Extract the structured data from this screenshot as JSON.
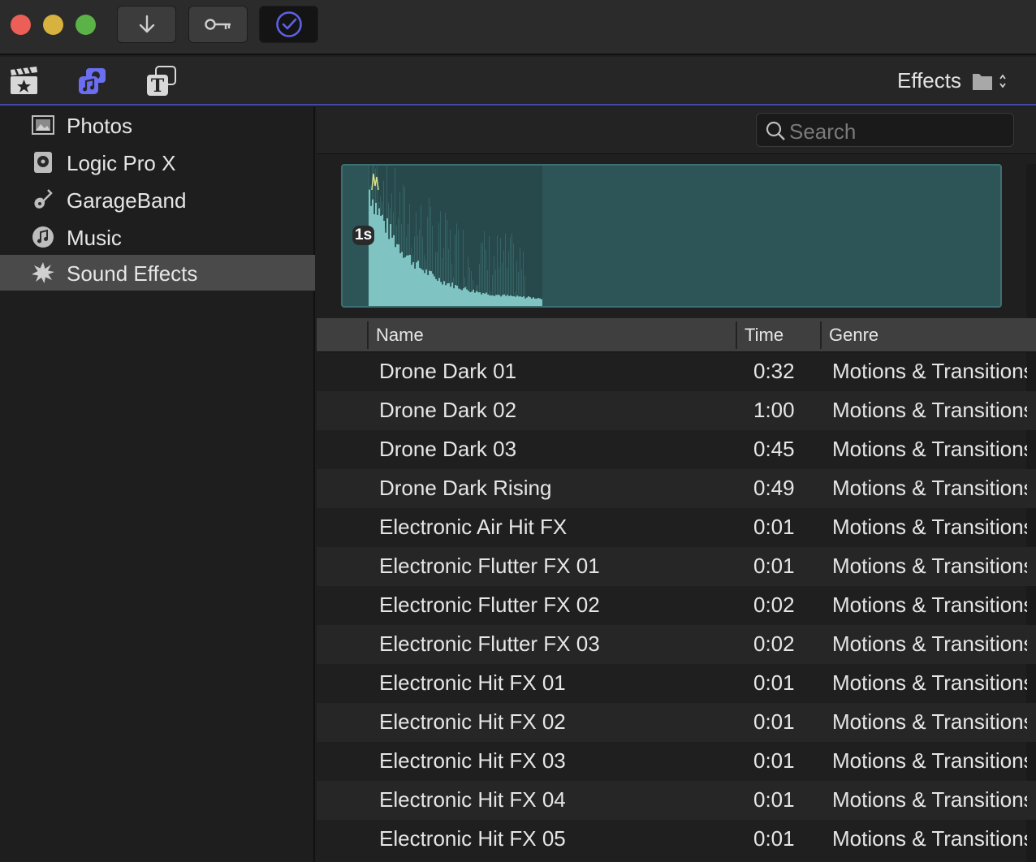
{
  "window": {
    "buttons": [
      {
        "name": "import-button",
        "icon": "arrow-down-icon"
      },
      {
        "name": "keywords-button",
        "icon": "key-icon"
      },
      {
        "name": "background-tasks-button",
        "icon": "checkmark-circle-icon"
      }
    ]
  },
  "toolbar": {
    "browser_label": "Effects"
  },
  "sidebar": {
    "items": [
      {
        "label": "Photos",
        "icon": "photos-icon"
      },
      {
        "label": "Logic Pro X",
        "icon": "logic-pro-icon"
      },
      {
        "label": "GarageBand",
        "icon": "guitar-icon"
      },
      {
        "label": "Music",
        "icon": "music-note-icon"
      },
      {
        "label": "Sound Effects",
        "icon": "burst-icon",
        "selected": true
      }
    ]
  },
  "search": {
    "placeholder": "Search"
  },
  "preview": {
    "time_label": "1s",
    "accent": "#2d5557",
    "wave_color": "#7fc4c2"
  },
  "table": {
    "columns": [
      "Name",
      "Time",
      "Genre"
    ],
    "rows": [
      {
        "name": "Drone Dark 01",
        "time": "0:32",
        "genre": "Motions & Transitions"
      },
      {
        "name": "Drone Dark 02",
        "time": "1:00",
        "genre": "Motions & Transitions"
      },
      {
        "name": "Drone Dark 03",
        "time": "0:45",
        "genre": "Motions & Transitions"
      },
      {
        "name": "Drone Dark Rising",
        "time": "0:49",
        "genre": "Motions & Transitions"
      },
      {
        "name": "Electronic Air Hit FX",
        "time": "0:01",
        "genre": "Motions & Transitions"
      },
      {
        "name": "Electronic Flutter FX 01",
        "time": "0:01",
        "genre": "Motions & Transitions"
      },
      {
        "name": "Electronic Flutter FX 02",
        "time": "0:02",
        "genre": "Motions & Transitions"
      },
      {
        "name": "Electronic Flutter FX 03",
        "time": "0:02",
        "genre": "Motions & Transitions"
      },
      {
        "name": "Electronic Hit FX 01",
        "time": "0:01",
        "genre": "Motions & Transitions"
      },
      {
        "name": "Electronic Hit FX 02",
        "time": "0:01",
        "genre": "Motions & Transitions"
      },
      {
        "name": "Electronic Hit FX 03",
        "time": "0:01",
        "genre": "Motions & Transitions"
      },
      {
        "name": "Electronic Hit FX 04",
        "time": "0:01",
        "genre": "Motions & Transitions"
      },
      {
        "name": "Electronic Hit FX 05",
        "time": "0:01",
        "genre": "Motions & Transitions"
      }
    ]
  }
}
